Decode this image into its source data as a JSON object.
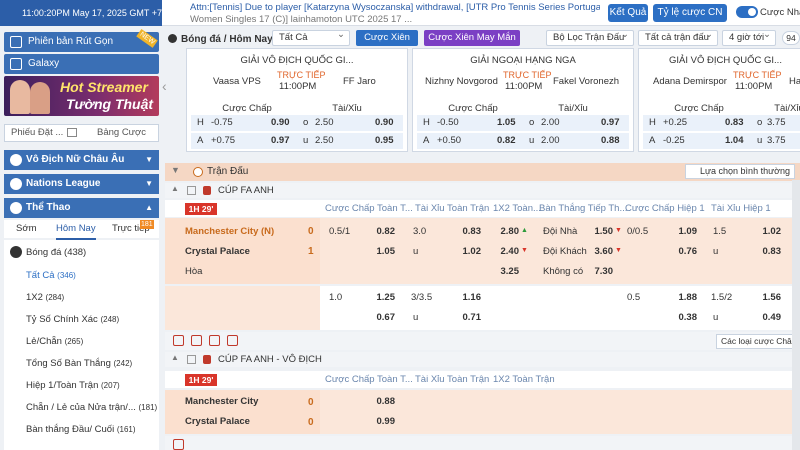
{
  "topbar": {
    "clock": "11:00:20PM May 17, 2025 GMT +7",
    "ticker_line1": "Attn:[Tennis] Due to player [Katarzyna Wysoczanska] withdrawal, [UTR Pro Tennis Series Portugal",
    "ticker_line2": "Women Singles 17 (C)] lainhamoton UTC 2025 17 ...",
    "result_button": "Kết Quả",
    "odds_dropdown": "Tỷ lệ cược CN",
    "toggle_label": "Cược Nhanh"
  },
  "sidebar": {
    "button1": "Phiên bản Rút Gọn",
    "button1_badge": "NEW",
    "button2": "Galaxy",
    "promo_line1": "Hot Streamer",
    "promo_line2": "Tường Thuật",
    "tab_left": "Phiếu Đặt ...",
    "tab_right": "Bảng Cược",
    "sections": [
      "Vô Địch Nữ Châu Âu",
      "Nations League",
      "Thể Thao"
    ],
    "subtabs": [
      "Sớm",
      "Hôm Nay",
      "Trực tiếp"
    ],
    "live_count": "181",
    "sport": "Bóng đá",
    "sport_count": "(438)",
    "items": [
      {
        "label": "Tất Cả",
        "count": "(346)"
      },
      {
        "label": "1X2",
        "count": "(284)"
      },
      {
        "label": "Tỷ Số Chính Xác",
        "count": "(248)"
      },
      {
        "label": "Lẻ/Chẵn",
        "count": "(265)"
      },
      {
        "label": "Tổng Số Bàn Thắng",
        "count": "(242)"
      },
      {
        "label": "Hiệp 1/Toàn Trận",
        "count": "(207)"
      },
      {
        "label": "Chẵn / Lẻ của Nửa trận/...",
        "count": "(181)"
      },
      {
        "label": "Bàn thắng Đầu/ Cuối",
        "count": "(161)"
      }
    ]
  },
  "strip": {
    "title": "Bóng đá / Hôm Nay",
    "filter_all": "Tất Cả",
    "btn_combo": "Cược Xiên",
    "btn_lucky": "Cược Xiên May Mắn",
    "filter_league": "Bộ Lọc Trận Đấu",
    "filter_matches": "Tất cả trận đấu",
    "filter_time": "4 giờ tới",
    "count1": "94",
    "count2": "94"
  },
  "cards": [
    {
      "league": "GIẢI VÔ ĐỊCH QUỐC GI...",
      "home": "Vaasa VPS",
      "away": "FF Jaro",
      "live": "TRỰC TIẾP",
      "time": "11:00PM",
      "h1": "Cược Chấp",
      "h2": "Tài/Xỉu",
      "r1": [
        "H",
        "-0.75",
        "0.90",
        "o",
        "2.50",
        "0.90"
      ],
      "r2": [
        "A",
        "+0.75",
        "0.97",
        "u",
        "2.50",
        "0.95"
      ]
    },
    {
      "league": "GIẢI NGOẠI HẠNG NGA",
      "home": "Nizhny Novgorod",
      "away": "Fakel Voronezh",
      "live": "TRỰC TIẾP",
      "time": "11:00PM",
      "h1": "Cược Chấp",
      "h2": "Tài/Xỉu",
      "r1": [
        "H",
        "-0.50",
        "1.05",
        "o",
        "2.00",
        "0.97"
      ],
      "r2": [
        "A",
        "+0.50",
        "0.82",
        "u",
        "2.00",
        "0.88"
      ]
    },
    {
      "league": "GIẢI VÔ ĐỊCH QUỐC GI...",
      "home": "Adana Demirspor",
      "away": "Ha",
      "live": "TRỰC TIẾP",
      "time": "11:00PM",
      "h1": "Cược Chấp",
      "h2": "Tài/Xỉu",
      "r1": [
        "H",
        "+0.25",
        "0.83",
        "o",
        "3.75",
        ""
      ],
      "r2": [
        "A",
        "-0.25",
        "1.04",
        "u",
        "3.75",
        ""
      ]
    }
  ],
  "tournament": {
    "title": "Trận Đấu",
    "sort": "Lựa chọn bình thường"
  },
  "league1": {
    "name": "CÚP FA ANH",
    "columns": [
      "Cược Chấp Toàn T...",
      "Tài Xỉu Toàn Trận",
      "1X2 Toàn...",
      "Bàn Thắng Tiếp Th...",
      "Cược Chấp Hiệp 1",
      "Tài Xỉu Hiệp 1"
    ],
    "badge": "1H 29'",
    "home": "Manchester City (N)",
    "home_score": "0",
    "away": "Crystal Palace",
    "away_score": "1",
    "draw": "Hòa",
    "main": {
      "hdp": [
        "0.5/1",
        "0.82",
        "",
        "1.05"
      ],
      "ou": [
        "3.0",
        "0.83",
        "u",
        "1.02"
      ],
      "x12": [
        "2.80",
        "2.40",
        "3.25"
      ],
      "next": [
        "Đội Nhà",
        "1.50",
        "Đội Khách",
        "3.60",
        "Không có",
        "7.30"
      ],
      "hdp1": [
        "0/0.5",
        "1.09",
        "",
        "0.76"
      ],
      "ou1": [
        "1.5",
        "1.02",
        "u",
        "0.83"
      ]
    },
    "alt": {
      "hdp": [
        "1.0",
        "1.25",
        "",
        "0.67"
      ],
      "ou": [
        "3/3.5",
        "1.16",
        "u",
        "0.71"
      ],
      "hdp1": [
        "0.5",
        "1.88",
        "",
        "0.38"
      ],
      "ou1": [
        "1.5/2",
        "1.56",
        "u",
        "0.49"
      ]
    },
    "all_bets": "Các loại cược Châu Á khác"
  },
  "league2": {
    "name": "CÚP FA ANH - VÔ ĐỊCH",
    "columns": [
      "Cược Chấp Toàn T...",
      "Tài Xỉu Toàn Trận",
      "1X2 Toàn Trận"
    ],
    "badge": "1H 29'",
    "home": "Manchester City",
    "home_score": "0",
    "away": "Crystal Palace",
    "away_score": "0",
    "odds": [
      "0.88",
      "0.99"
    ]
  }
}
